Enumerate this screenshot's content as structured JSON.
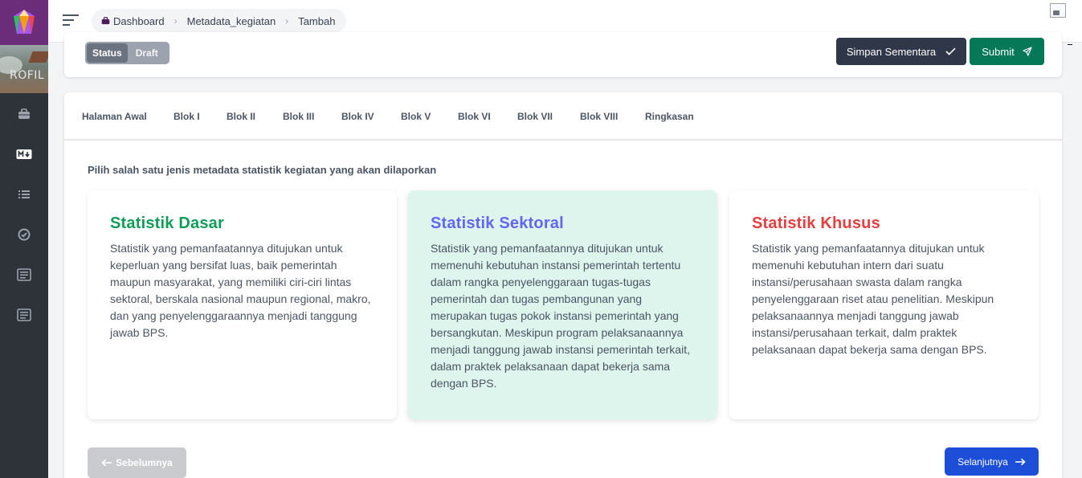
{
  "breadcrumb": {
    "items": [
      "Dashboard",
      "Metadata_kegiatan",
      "Tambah"
    ]
  },
  "sidebar": {
    "banner_text": "ROFIL",
    "nav_icons": [
      "briefcase-icon",
      "markdown-icon",
      "list-icon",
      "check-circle-icon",
      "document-icon",
      "document-icon"
    ]
  },
  "status": {
    "label": "Status",
    "value": "Draft"
  },
  "actions": {
    "save_label": "Simpan Sementara",
    "submit_label": "Submit"
  },
  "tabs": [
    "Halaman Awal",
    "Blok I",
    "Blok II",
    "Blok III",
    "Blok IV",
    "Blok V",
    "Blok VI",
    "Blok VII",
    "Blok VIII",
    "Ringkasan"
  ],
  "intro": "Pilih salah satu jenis metadata statistik kegiatan yang akan dilaporkan",
  "options": [
    {
      "title": "Statistik Dasar",
      "color": "#0f9d58",
      "description": "Statistik yang pemanfaatannya ditujukan untuk keperluan yang bersifat luas, baik pemerintah maupun masyarakat, yang memiliki ciri-ciri lintas sektoral, berskala nasional maupun regional, makro, dan yang penyelenggaraannya menjadi tanggung jawab BPS."
    },
    {
      "title": "Statistik Sektoral",
      "color": "#6366f1",
      "description": "Statistik yang pemanfaatannya ditujukan untuk memenuhi kebutuhan instansi pemerintah tertentu dalam rangka penyelenggaraan tugas-tugas pemerintah dan tugas pembangunan yang merupakan tugas pokok instansi pemerintah yang bersangkutan. Meskipun program pelaksanaannya menjadi tanggung jawab instansi pemerintah terkait, dalam praktek pelaksanaan dapat bekerja sama dengan BPS."
    },
    {
      "title": "Statistik Khusus",
      "color": "#e53e3e",
      "description": "Statistik yang pemanfaatannya ditujukan untuk memenuhi kebutuhan intern dari suatu instansi/perusahaan swasta dalam rangka penyelenggaraan riset atau penelitian. Meskipun pelaksanaannya menjadi tanggung jawab instansi/perusahaan terkait, dalm praktek pelaksanaan dapat bekerja sama dengan BPS."
    }
  ],
  "nav": {
    "prev_label": "Sebelumnya",
    "next_label": "Selanjutnya"
  }
}
